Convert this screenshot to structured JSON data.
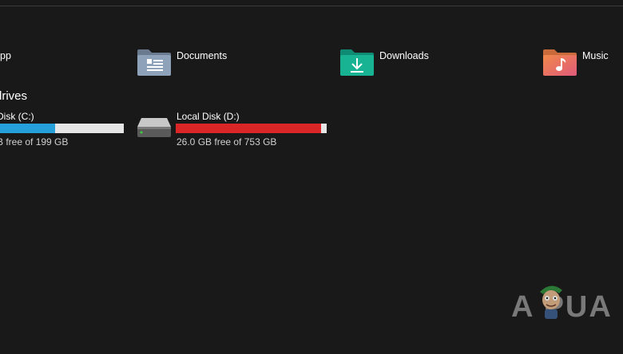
{
  "folders": [
    {
      "label": "pp",
      "icon": "app-folder-icon"
    },
    {
      "label": "Documents",
      "icon": "documents-folder-icon"
    },
    {
      "label": "Downloads",
      "icon": "downloads-folder-icon"
    },
    {
      "label": "Music",
      "icon": "music-folder-icon"
    }
  ],
  "section": {
    "title": "drives"
  },
  "drives": [
    {
      "name": "Disk (C:)",
      "free_text": "B free of 199 GB",
      "used_fraction": 0.45,
      "fill_color": "#26a0da"
    },
    {
      "name": "Local Disk (D:)",
      "free_text": "26.0 GB free of 753 GB",
      "used_fraction": 0.965,
      "fill_color": "#da2626"
    }
  ],
  "watermark": {
    "text": "A  PUA"
  }
}
